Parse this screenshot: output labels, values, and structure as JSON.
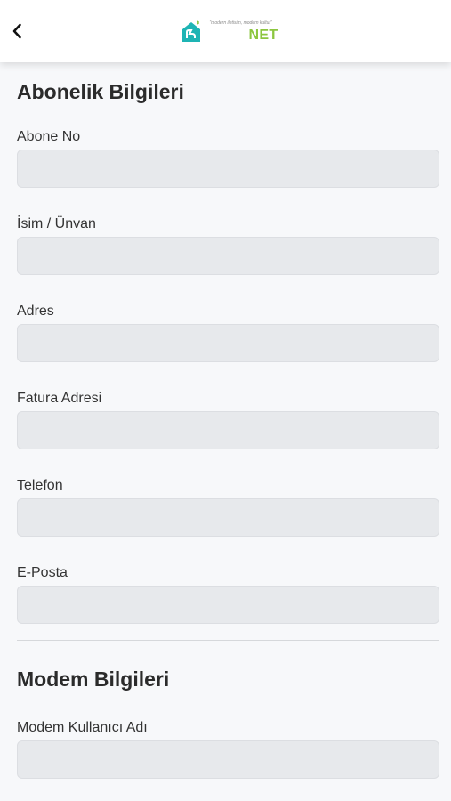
{
  "header": {
    "back_icon": "chevron-left-icon",
    "logo": {
      "tagline": "“modern iletisim, modern kultur”",
      "brand": "NET",
      "brand_color": "#8cc63f",
      "mark_color": "#1eb4b4"
    }
  },
  "subscription": {
    "title": "Abonelik Bilgileri",
    "fields": [
      {
        "label": "Abone No",
        "value": ""
      },
      {
        "label": "İsim / Ünvan",
        "value": ""
      },
      {
        "label": "Adres",
        "value": ""
      },
      {
        "label": "Fatura Adresi",
        "value": ""
      },
      {
        "label": "Telefon",
        "value": ""
      },
      {
        "label": "E-Posta",
        "value": ""
      }
    ]
  },
  "modem": {
    "title": "Modem Bilgileri",
    "fields": [
      {
        "label": "Modem Kullanıcı Adı",
        "value": ""
      }
    ]
  }
}
